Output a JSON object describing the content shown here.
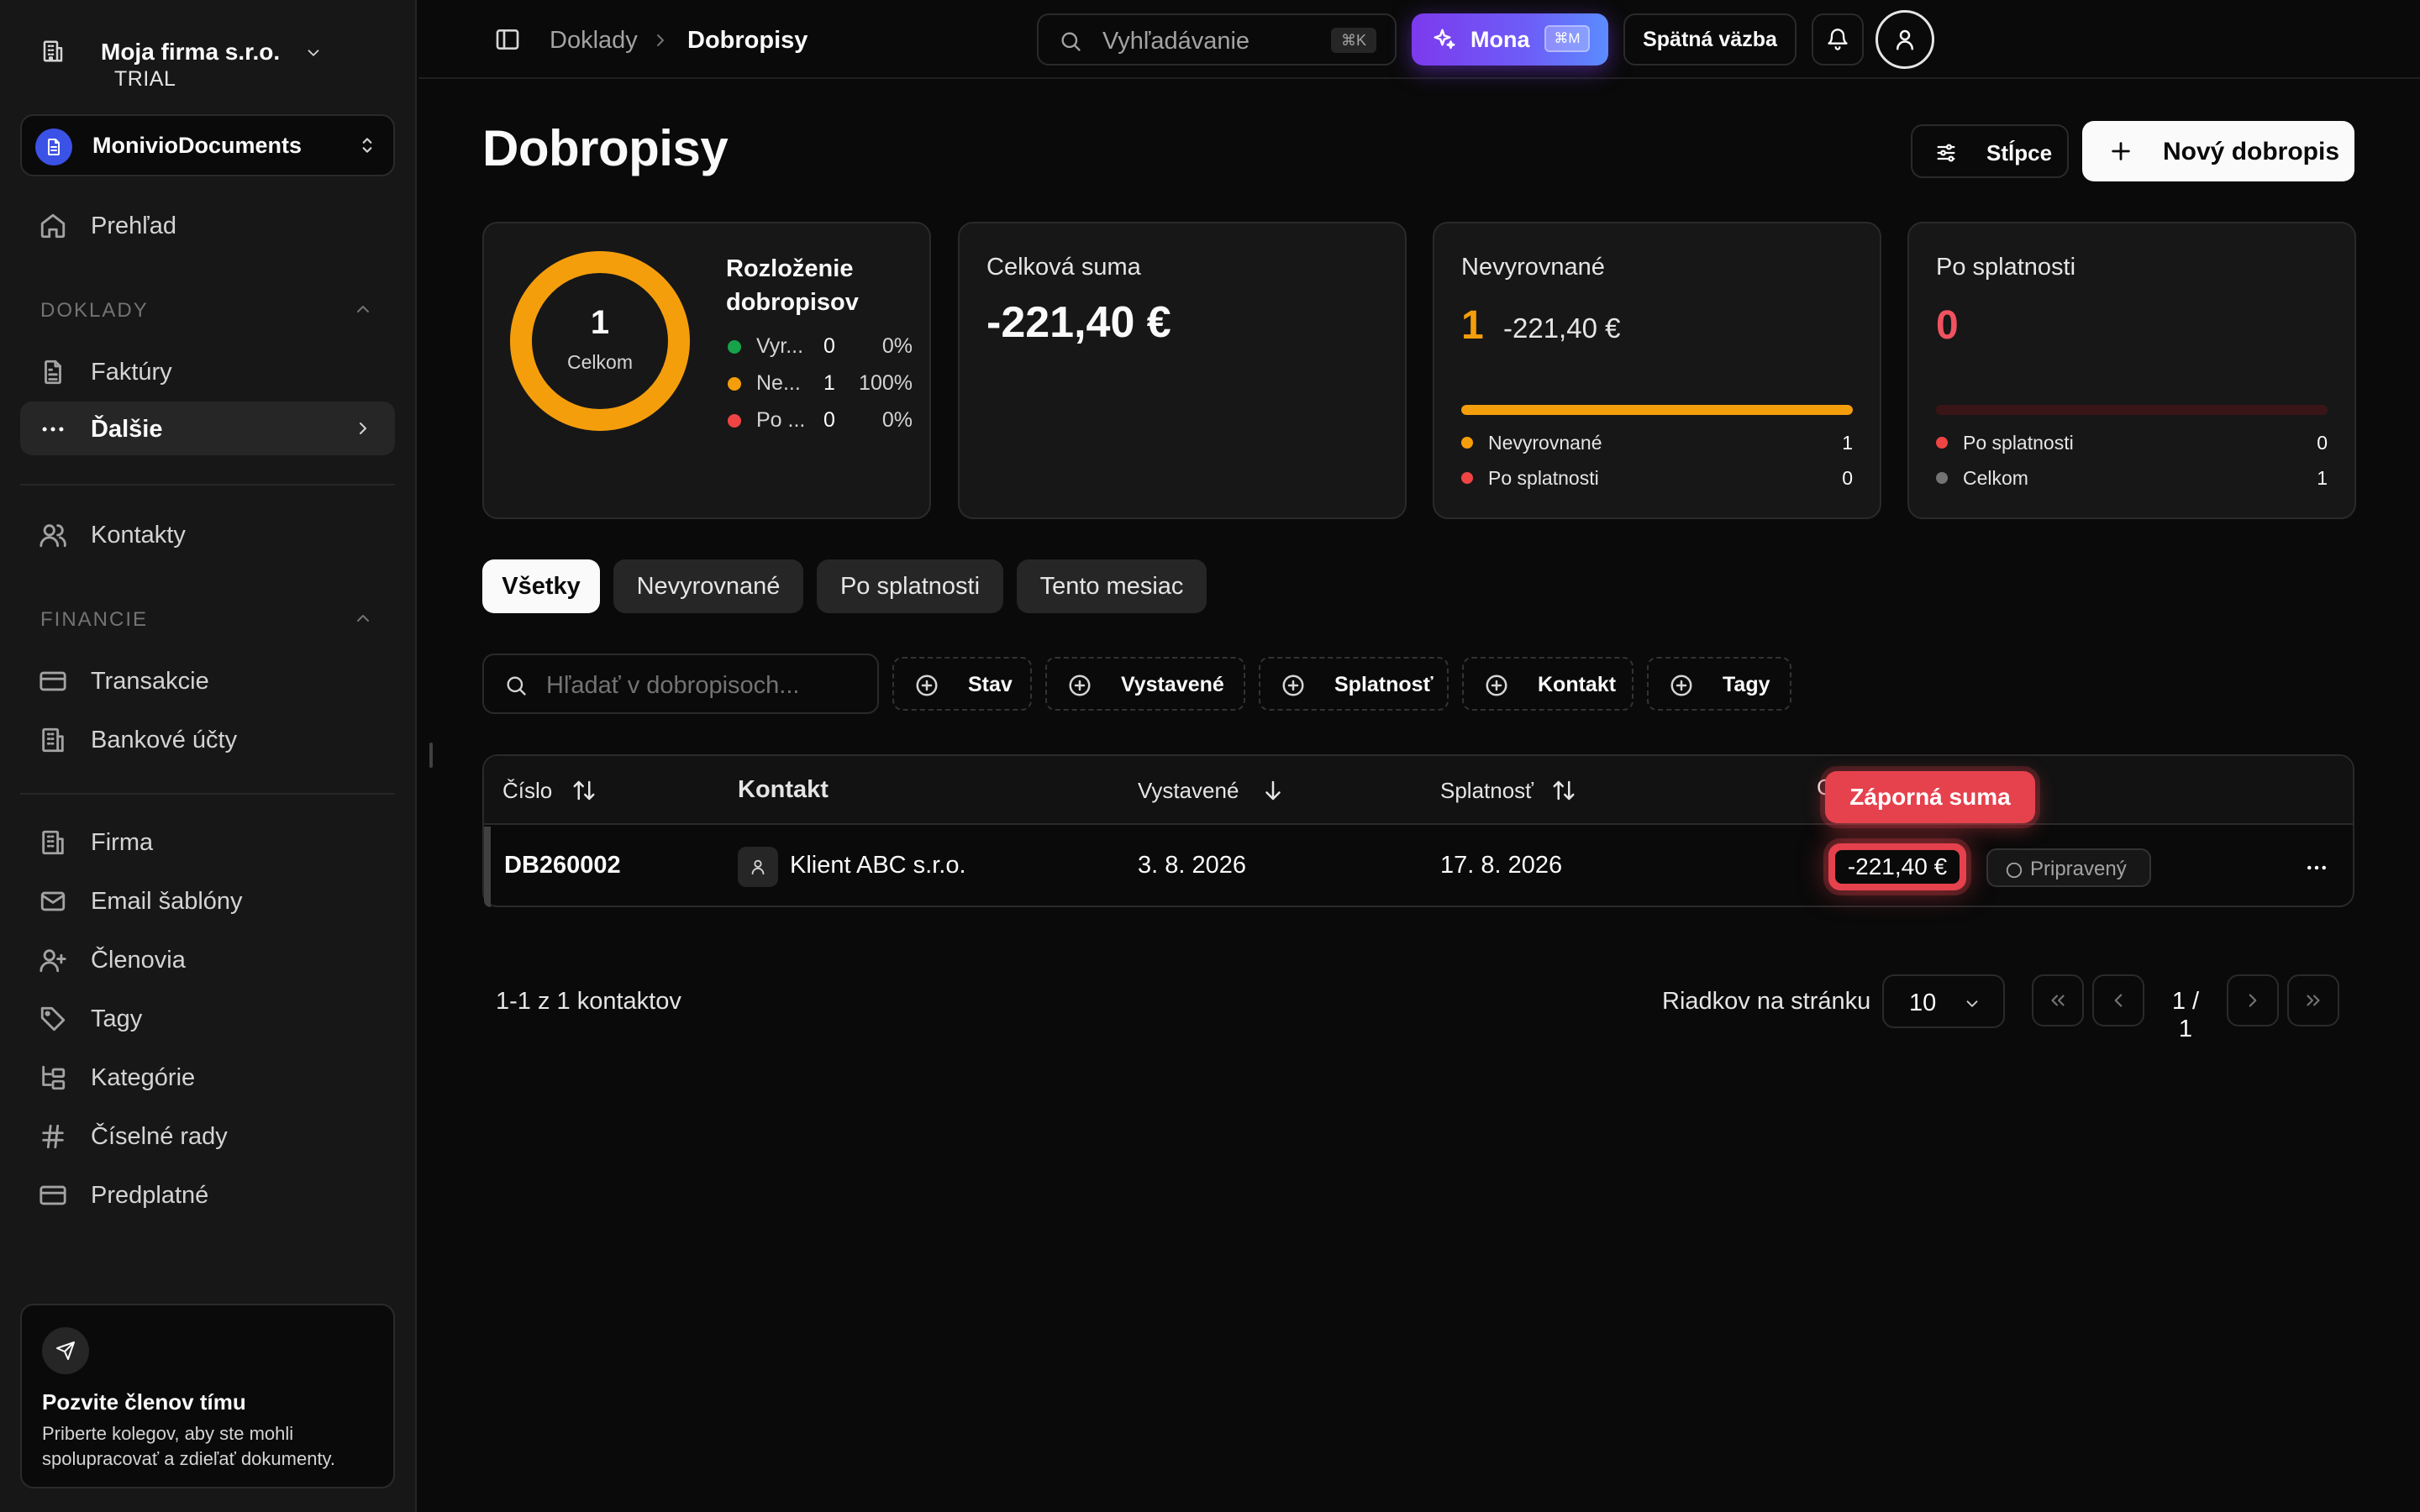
{
  "sidebar": {
    "company_name": "Moja firma s.r.o.",
    "plan": "TRIAL",
    "workspace": "MonivioDocuments",
    "overview": "Prehľad",
    "section_documents": "DOKLADY",
    "invoices": "Faktúry",
    "more": "Ďalšie",
    "contacts": "Kontakty",
    "section_finance": "FINANCIE",
    "transactions": "Transakcie",
    "bank_accounts": "Bankové účty",
    "firm": "Firma",
    "email_templates": "Email šablóny",
    "members": "Členovia",
    "tags": "Tagy",
    "categories": "Kategórie",
    "number_series": "Číselné rady",
    "subscription": "Predplatné",
    "invite_title": "Pozvite členov tímu",
    "invite_desc": "Priberte kolegov, aby ste mohli spolupracovať a zdieľať dokumenty."
  },
  "topbar": {
    "breadcrumb_parent": "Doklady",
    "breadcrumb_current": "Dobropisy",
    "search_placeholder": "Vyhľadávanie",
    "search_kbd": "⌘K",
    "mona_label": "Mona",
    "mona_kbd": "⌘M",
    "feedback": "Spätná väzba"
  },
  "page": {
    "title": "Dobropisy",
    "columns_button": "Stĺpce",
    "new_button": "Nový dobropis"
  },
  "cards": {
    "distribution": {
      "title": "Rozloženie dobropisov",
      "total": "1",
      "total_label": "Celkom",
      "legend": [
        {
          "name": "Vyr...",
          "count": "0",
          "pct": "0%",
          "color": "#16a34a",
          "value": 0
        },
        {
          "name": "Ne...",
          "count": "1",
          "pct": "100%",
          "color": "#f59e0b",
          "value": 1
        },
        {
          "name": "Po ...",
          "count": "0",
          "pct": "0%",
          "color": "#ef4444",
          "value": 0
        }
      ]
    },
    "total_sum": {
      "title": "Celková suma",
      "amount": "-221,40 €"
    },
    "unsettled": {
      "title": "Nevyrovnané",
      "count": "1",
      "amount": "-221,40 €",
      "progress": 1.0,
      "rows": [
        {
          "name": "Nevyrovnané",
          "value": "1",
          "color": "#f59e0b"
        },
        {
          "name": "Po splatnosti",
          "value": "0",
          "color": "#ef4444"
        }
      ]
    },
    "overdue": {
      "title": "Po splatnosti",
      "count": "0",
      "progress": 0,
      "rows": [
        {
          "name": "Po splatnosti",
          "value": "0",
          "color": "#ef4444"
        },
        {
          "name": "Celkom",
          "value": "1",
          "color": "#737373"
        }
      ]
    }
  },
  "tabs": [
    {
      "label": "Všetky",
      "active": true
    },
    {
      "label": "Nevyrovnané",
      "active": false
    },
    {
      "label": "Po splatnosti",
      "active": false
    },
    {
      "label": "Tento mesiac",
      "active": false
    }
  ],
  "filters": {
    "search_placeholder": "Hľadať v dobropisoch...",
    "chips": [
      "Stav",
      "Vystavené",
      "Splatnosť",
      "Kontakt",
      "Tagy"
    ]
  },
  "table": {
    "columns": {
      "number": "Číslo",
      "contact": "Kontakt",
      "issued": "Vystavené",
      "due": "Splatnosť",
      "amount_hidden": "C"
    },
    "rows": [
      {
        "number": "DB260002",
        "contact": "Klient ABC s.r.o.",
        "issued": "3. 8. 2026",
        "due": "17. 8. 2026",
        "amount": "-221,40 €",
        "status": "Pripravený"
      }
    ],
    "tooltip": "Záporná suma"
  },
  "pagination": {
    "info": "1-1 z 1 kontaktov",
    "rows_label": "Riadkov na stránku",
    "rows_value": "10",
    "page": "1 / 1"
  },
  "colors": {
    "accent_orange": "#f59e0b",
    "danger_red": "#e5424d",
    "mona_purple": "#7c3aed"
  }
}
